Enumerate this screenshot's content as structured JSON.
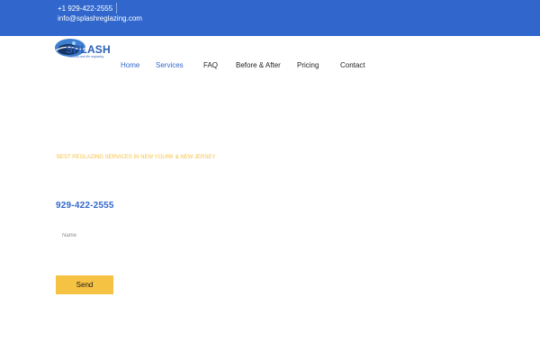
{
  "topbar": {
    "phone": "+1 929-422-2555",
    "email": "info@splashreglazing.com"
  },
  "logo": {
    "name": "SPLASH",
    "tagline": "bathtub and tile reglazing"
  },
  "nav": {
    "items": [
      {
        "label": "Home",
        "active": true
      },
      {
        "label": "Services",
        "active": false,
        "dropdown": true
      },
      {
        "label": "FAQ",
        "active": false
      },
      {
        "label": "Before & After",
        "active": false
      },
      {
        "label": "Pricing",
        "active": false
      },
      {
        "label": "Contact",
        "active": false
      }
    ]
  },
  "hero": {
    "tagline": "BEST REGLAZING SERVICES IN NEW YOURK & NEW JERSEY",
    "phone": "929-422-2555"
  },
  "form": {
    "name_placeholder": "Name",
    "name_value": "",
    "send_label": "Send"
  },
  "colors": {
    "brand_blue": "#3167cc",
    "accent_yellow": "#f6c244"
  }
}
